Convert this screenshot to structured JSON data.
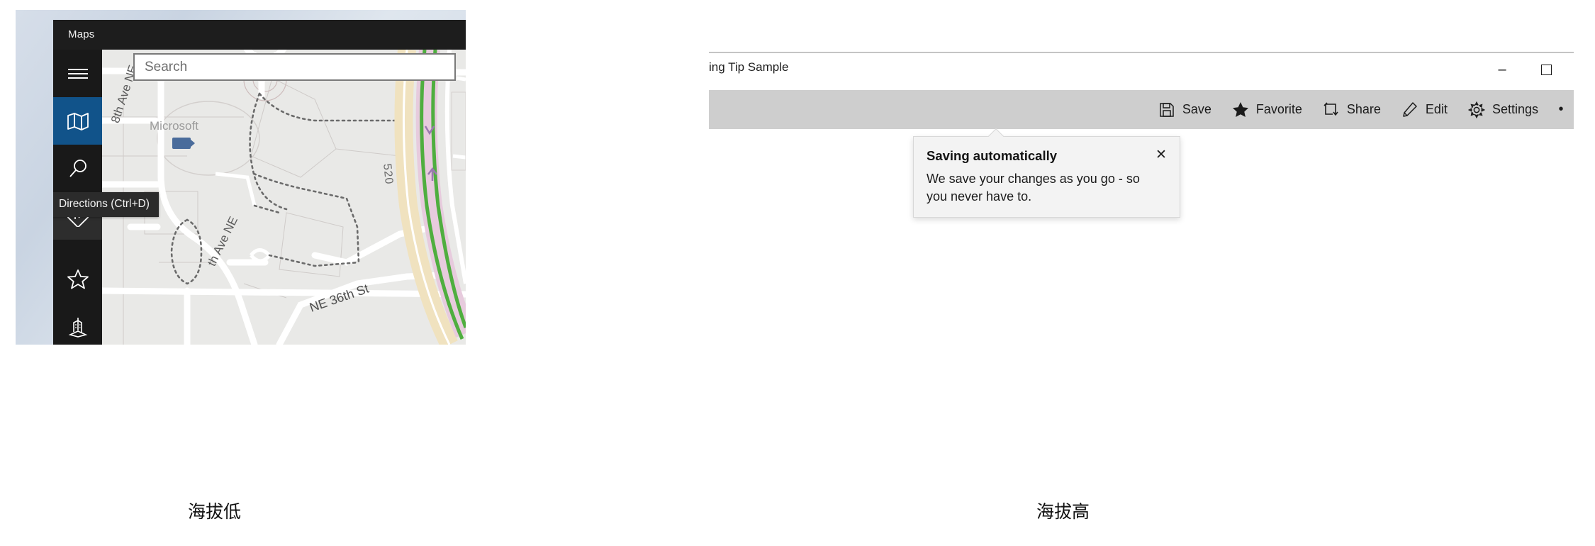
{
  "left_example": {
    "caption": "海拔低",
    "window": {
      "app_title": "Maps",
      "search": {
        "placeholder": "Search",
        "value": ""
      },
      "nav_items": [
        {
          "name": "hamburger",
          "icon": "hamburger-menu-icon",
          "state": "normal"
        },
        {
          "name": "map",
          "icon": "map-icon",
          "state": "selected"
        },
        {
          "name": "search",
          "icon": "search-icon",
          "state": "normal"
        },
        {
          "name": "directions",
          "icon": "directions-icon",
          "state": "hovered"
        },
        {
          "name": "favorites",
          "icon": "star-icon",
          "state": "normal"
        },
        {
          "name": "3d-cities",
          "icon": "3d-cities-icon",
          "state": "normal"
        }
      ],
      "tooltip": {
        "text": "Directions (Ctrl+D)"
      },
      "map_labels": {
        "campus": "Microsoft",
        "street_vertical": "8th Ave NE",
        "street_lower": "th Ave NE",
        "street_diagonal": "NE 36th St",
        "highway": "520"
      }
    }
  },
  "right_example": {
    "caption": "海拔高",
    "window": {
      "title": "ing Tip Sample",
      "caption_buttons": [
        {
          "name": "minimize",
          "glyph": "–"
        },
        {
          "name": "maximize",
          "glyph": "□"
        }
      ],
      "command_bar": [
        {
          "label": "Save",
          "icon": "save-icon"
        },
        {
          "label": "Favorite",
          "icon": "star-filled-icon"
        },
        {
          "label": "Share",
          "icon": "share-icon"
        },
        {
          "label": "Edit",
          "icon": "pencil-icon"
        },
        {
          "label": "Settings",
          "icon": "gear-icon"
        }
      ],
      "overflow_glyph": "•",
      "teaching_tip": {
        "heading": "Saving automatically",
        "body": "We save your changes as you go - so you never have to.",
        "close_glyph": "✕"
      }
    }
  },
  "colors": {
    "accent_selected": "#11538a",
    "nav_background": "#191919",
    "title_bar": "#1d1d1d",
    "command_bar": "#cecece",
    "tip_background": "#f3f3f3",
    "map_background": "#e9e9e7"
  }
}
